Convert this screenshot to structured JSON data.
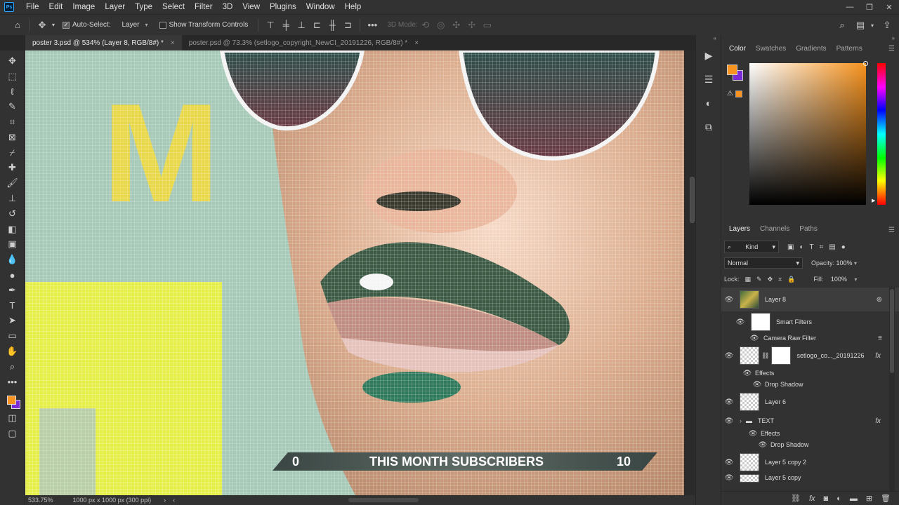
{
  "app": {
    "logo": "Ps",
    "menu": [
      "File",
      "Edit",
      "Image",
      "Layer",
      "Type",
      "Select",
      "Filter",
      "3D",
      "View",
      "Plugins",
      "Window",
      "Help"
    ]
  },
  "options": {
    "auto_select_label": "Auto-Select:",
    "auto_select_target": "Layer",
    "show_transform_label": "Show Transform Controls",
    "mode3d_label": "3D Mode:"
  },
  "tabs": [
    {
      "label": "poster 3.psd @ 534% (Layer 8, RGB/8#) *"
    },
    {
      "label": "poster.psd @ 73.3% (setlogo_copyright_NewCI_20191226, RGB/8#) *"
    }
  ],
  "canvas": {
    "banner_left": "0",
    "banner_title": "THIS MONTH SUBSCRIBERS",
    "banner_right": "10",
    "letter": "M"
  },
  "status": {
    "zoom": "533.75%",
    "doc_info": "1000 px x 1000 px (300 ppi)"
  },
  "colors": {
    "foreground": "#f7931e",
    "background": "#7a2bd6",
    "accent_selected_row": "#3d3d3d"
  },
  "color_panel": {
    "tabs": [
      "Color",
      "Swatches",
      "Gradients",
      "Patterns"
    ]
  },
  "layers_panel": {
    "tabs": [
      "Layers",
      "Channels",
      "Paths"
    ],
    "kind_label": "Kind",
    "blend_mode": "Normal",
    "opacity_label": "Opacity:",
    "opacity_value": "100%",
    "lock_label": "Lock:",
    "fill_label": "Fill:",
    "fill_value": "100%",
    "rows": {
      "layer8": "Layer 8",
      "smart_filters": "Smart Filters",
      "camera_raw": "Camera Raw Filter",
      "setlogo": "setlogo_co..._20191226",
      "effects1": "Effects",
      "drop_shadow1": "Drop Shadow",
      "layer6": "Layer 6",
      "text_group": "TEXT",
      "effects2": "Effects",
      "drop_shadow2": "Drop Shadow",
      "layer5copy2": "Layer 5 copy 2",
      "layer5copy": "Layer 5 copy"
    }
  }
}
